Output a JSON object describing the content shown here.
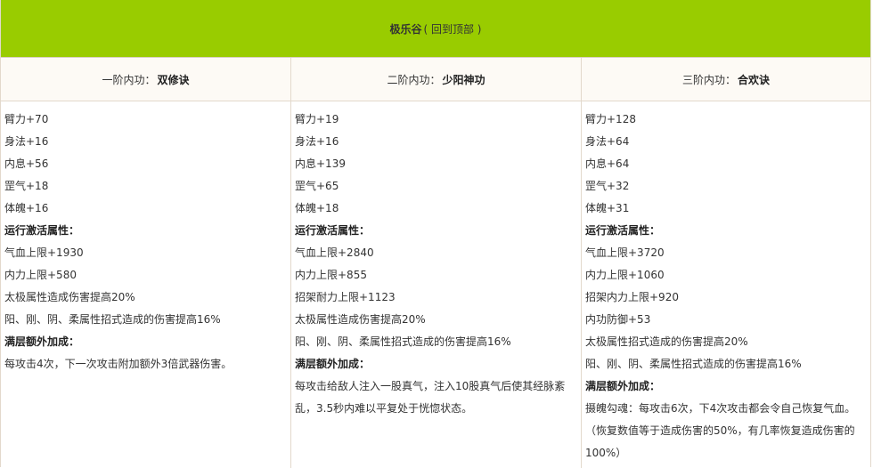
{
  "title": {
    "main": "极乐谷",
    "link": "( 回到顶部 )"
  },
  "columns": [
    {
      "label": "一阶内功：",
      "name": "双修诀",
      "lines": [
        {
          "text": "臂力+70",
          "bold": false
        },
        {
          "text": "身法+16",
          "bold": false
        },
        {
          "text": "内息+56",
          "bold": false
        },
        {
          "text": "罡气+18",
          "bold": false
        },
        {
          "text": "体魄+16",
          "bold": false
        },
        {
          "text": "运行激活属性：",
          "bold": true
        },
        {
          "text": "气血上限+1930",
          "bold": false
        },
        {
          "text": "内力上限+580",
          "bold": false
        },
        {
          "text": "太极属性造成伤害提高20%",
          "bold": false
        },
        {
          "text": "阳、刚、阴、柔属性招式造成的伤害提高16%",
          "bold": false
        },
        {
          "text": "满层额外加成：",
          "bold": true
        },
        {
          "text": "每攻击4次，下一次攻击附加额外3倍武器伤害。",
          "bold": false
        }
      ]
    },
    {
      "label": "二阶内功：",
      "name": "少阳神功",
      "lines": [
        {
          "text": "臂力+19",
          "bold": false
        },
        {
          "text": "身法+16",
          "bold": false
        },
        {
          "text": "内息+139",
          "bold": false
        },
        {
          "text": "罡气+65",
          "bold": false
        },
        {
          "text": "体魄+18",
          "bold": false
        },
        {
          "text": "运行激活属性：",
          "bold": true
        },
        {
          "text": "气血上限+2840",
          "bold": false
        },
        {
          "text": "内力上限+855",
          "bold": false
        },
        {
          "text": "招架耐力上限+1123",
          "bold": false
        },
        {
          "text": "太极属性造成伤害提高20%",
          "bold": false
        },
        {
          "text": "阳、刚、阴、柔属性招式造成的伤害提高16%",
          "bold": false
        },
        {
          "text": "满层额外加成：",
          "bold": true
        },
        {
          "text": "每攻击给敌人注入一股真气，注入10股真气后使其经脉紊",
          "bold": false
        },
        {
          "text": "乱，3.5秒内难以平复处于恍惚状态。",
          "bold": false
        }
      ]
    },
    {
      "label": "三阶内功：",
      "name": "合欢诀",
      "lines": [
        {
          "text": "臂力+128",
          "bold": false
        },
        {
          "text": "身法+64",
          "bold": false
        },
        {
          "text": "内息+64",
          "bold": false
        },
        {
          "text": "罡气+32",
          "bold": false
        },
        {
          "text": "体魄+31",
          "bold": false
        },
        {
          "text": "运行激活属性：",
          "bold": true
        },
        {
          "text": "气血上限+3720",
          "bold": false
        },
        {
          "text": "内力上限+1060",
          "bold": false
        },
        {
          "text": "招架内力上限+920",
          "bold": false
        },
        {
          "text": "内功防御+53",
          "bold": false
        },
        {
          "text": "太极属性招式造成的伤害提高20%",
          "bold": false
        },
        {
          "text": "阳、刚、阴、柔属性招式造成的伤害提高16%",
          "bold": false
        },
        {
          "text": "满层额外加成：",
          "bold": true
        },
        {
          "text": "摄魄勾魂：每攻击6次，下4次攻击都会令自己恢复气血。",
          "bold": false
        },
        {
          "text": "（恢复数值等于造成伤害的50%，有几率恢复造成伤害的",
          "bold": false
        },
        {
          "text": "100%）",
          "bold": false
        }
      ]
    }
  ]
}
